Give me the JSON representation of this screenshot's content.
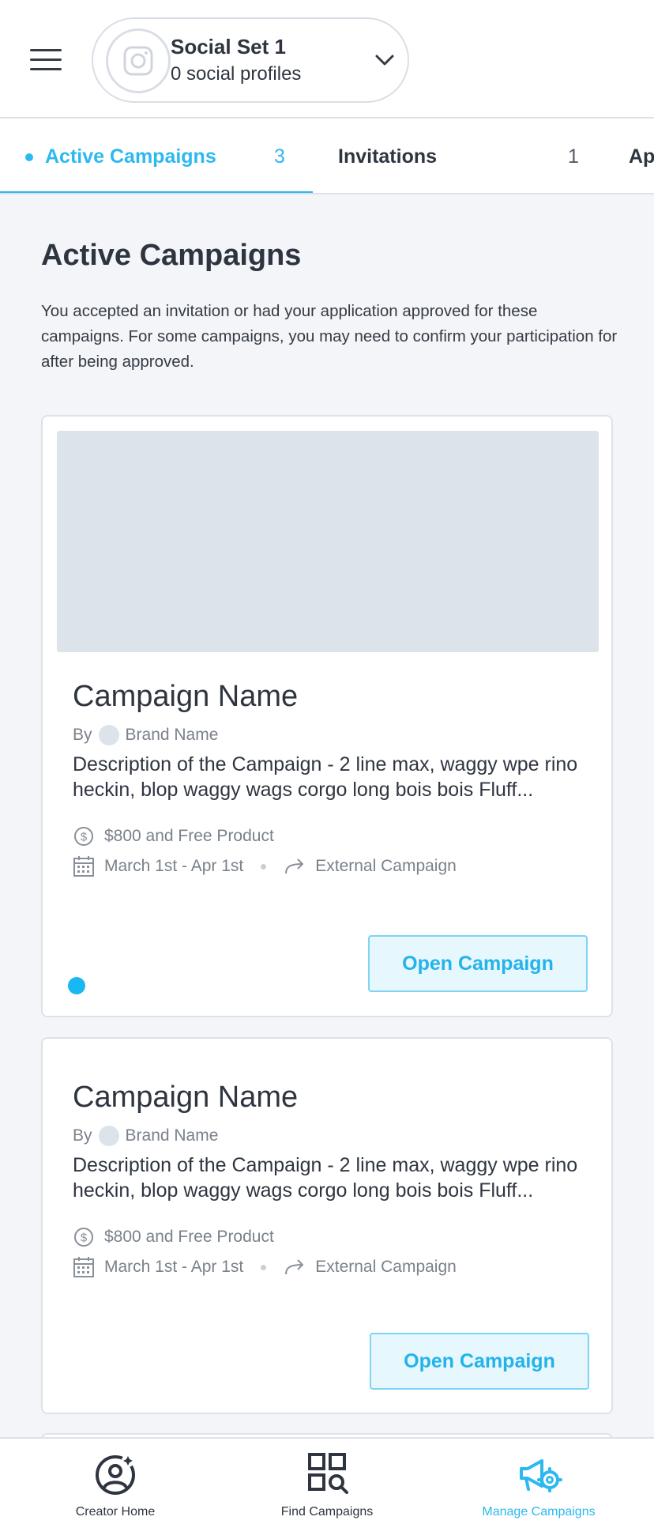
{
  "header": {
    "social_set": {
      "title": "Social Set 1",
      "subtitle": "0 social profiles",
      "icon": "instagram-icon"
    }
  },
  "tabs": [
    {
      "label": "Active Campaigns",
      "count": "3",
      "active": true
    },
    {
      "label": "Invitations",
      "count": "1",
      "active": false
    },
    {
      "label": "Ap",
      "count": "",
      "active": false
    }
  ],
  "page": {
    "title": "Active Campaigns",
    "description": "You accepted an invitation or had your application approved for these campaigns. For some campaigns, you may need to confirm your participation for after being approved."
  },
  "campaigns": [
    {
      "name": "Campaign Name",
      "by": "By",
      "brand": "Brand Name",
      "description": "Description of the Campaign - 2 line max, waggy wpe rino heckin, blop waggy wags corgo long bois bois Fluff...",
      "compensation": "$800 and Free Product",
      "dates": "March 1st - Apr 1st",
      "type": "External Campaign",
      "button": "Open Campaign"
    },
    {
      "name": "Campaign Name",
      "by": "By",
      "brand": "Brand Name",
      "description": "Description of the Campaign - 2 line max, waggy wpe rino heckin, blop waggy wags corgo long bois bois Fluff...",
      "compensation": "$800 and Free Product",
      "dates": "March 1st - Apr 1st",
      "type": "External Campaign",
      "button": "Open Campaign"
    }
  ],
  "bottom_nav": [
    {
      "label": "Creator Home",
      "icon": "creator-home-icon"
    },
    {
      "label": "Find Campaigns",
      "icon": "find-campaigns-icon"
    },
    {
      "label": "Manage Campaigns",
      "icon": "manage-campaigns-icon",
      "active": true
    }
  ],
  "colors": {
    "accent": "#2bb9ef",
    "text": "#2f3540",
    "muted": "#7a818b",
    "background": "#f3f5f8",
    "placeholder": "#dde3eb"
  }
}
